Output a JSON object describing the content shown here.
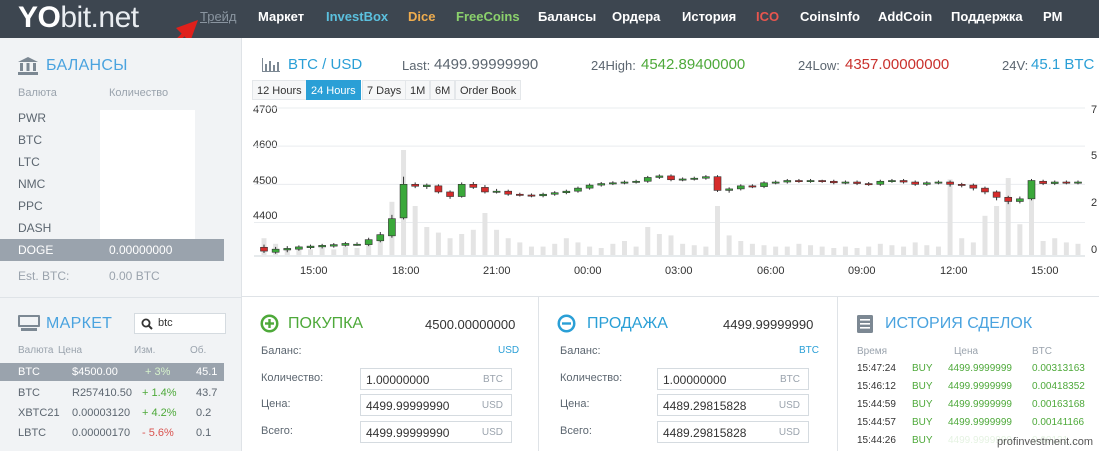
{
  "logo": {
    "yo": "YO",
    "rest": "bit.net"
  },
  "nav": [
    {
      "label": "Трейд",
      "color": "#8a95a0"
    },
    {
      "label": "Маркет",
      "color": "#ffffff"
    },
    {
      "label": "InvestBox",
      "color": "#5bc0de"
    },
    {
      "label": "Dice",
      "color": "#f0ad4e"
    },
    {
      "label": "FreeCoins",
      "color": "#8bd16c"
    },
    {
      "label": "Балансы",
      "color": "#ffffff"
    },
    {
      "label": "Ордера",
      "color": "#ffffff"
    },
    {
      "label": "История",
      "color": "#ffffff"
    },
    {
      "label": "ICO",
      "color": "#e8554e"
    },
    {
      "label": "CoinsInfo",
      "color": "#ffffff"
    },
    {
      "label": "AddCoin",
      "color": "#ffffff"
    },
    {
      "label": "Поддержка",
      "color": "#ffffff"
    },
    {
      "label": "PM",
      "color": "#ffffff"
    }
  ],
  "balances": {
    "title": "БАЛАНСЫ",
    "col_currency": "Валюта",
    "col_amount": "Количество",
    "rows": [
      {
        "currency": "PWR",
        "amount": ""
      },
      {
        "currency": "BTC",
        "amount": ""
      },
      {
        "currency": "LTC",
        "amount": ""
      },
      {
        "currency": "NMC",
        "amount": ""
      },
      {
        "currency": "PPC",
        "amount": ""
      },
      {
        "currency": "DASH",
        "amount": ""
      },
      {
        "currency": "DOGE",
        "amount": "0.00000000"
      }
    ],
    "est_label": "Est. BTC:",
    "est_value": "0.00 BTC"
  },
  "market": {
    "title": "МАРКЕТ",
    "search_value": "btc",
    "cols": [
      "Валюта",
      "Цена",
      "Изм.",
      "Об."
    ],
    "rows": [
      {
        "cur": "BTC",
        "price": "$4500.00",
        "change": "+ 3%",
        "vol": "45.1",
        "dir": "up"
      },
      {
        "cur": "BTC",
        "price": "R257410.50",
        "change": "+ 1.4%",
        "vol": "43.7",
        "dir": "up"
      },
      {
        "cur": "XBTC21",
        "price": "0.00003120",
        "change": "+ 4.2%",
        "vol": "0.2",
        "dir": "up"
      },
      {
        "cur": "LBTC",
        "price": "0.00000170",
        "change": "- 5.6%",
        "vol": "0.1",
        "dir": "down"
      }
    ]
  },
  "ticker": {
    "pair": "BTC / USD",
    "last_label": "Last:",
    "last": "4499.99999990",
    "high_label": "24High:",
    "high": "4542.89400000",
    "low_label": "24Low:",
    "low": "4357.00000000",
    "vol_label": "24V:",
    "vol": "45.1 BTC"
  },
  "timeframes": [
    "12 Hours",
    "24 Hours",
    "7 Days",
    "1M",
    "6M",
    "Order Book"
  ],
  "active_timeframe": "24 Hours",
  "chart_data": {
    "type": "candlestick",
    "x_ticks": [
      "15:00",
      "18:00",
      "21:00",
      "00:00",
      "03:00",
      "06:00",
      "09:00",
      "12:00",
      "15:00"
    ],
    "y_ticks": [
      4700,
      4600,
      4500,
      4400
    ],
    "ylim": [
      4320,
      4700
    ],
    "volume_axis_ticks": [
      "7",
      "5",
      "2",
      "0"
    ],
    "grid": true,
    "candles": [
      [
        4335,
        4325,
        4342,
        4320
      ],
      [
        4322,
        4330,
        4336,
        4318
      ],
      [
        4328,
        4332,
        4338,
        4322
      ],
      [
        4330,
        4336,
        4340,
        4326
      ],
      [
        4334,
        4338,
        4342,
        4330
      ],
      [
        4336,
        4340,
        4344,
        4332
      ],
      [
        4338,
        4342,
        4346,
        4334
      ],
      [
        4340,
        4345,
        4349,
        4337
      ],
      [
        4342,
        4343,
        4348,
        4339
      ],
      [
        4342,
        4355,
        4360,
        4338
      ],
      [
        4352,
        4368,
        4375,
        4348
      ],
      [
        4365,
        4410,
        4420,
        4360
      ],
      [
        4412,
        4500,
        4520,
        4408
      ],
      [
        4500,
        4495,
        4505,
        4490
      ],
      [
        4494,
        4498,
        4502,
        4488
      ],
      [
        4496,
        4480,
        4500,
        4476
      ],
      [
        4480,
        4468,
        4484,
        4462
      ],
      [
        4468,
        4500,
        4505,
        4465
      ],
      [
        4500,
        4492,
        4506,
        4488
      ],
      [
        4492,
        4480,
        4498,
        4476
      ],
      [
        4482,
        4482,
        4488,
        4476
      ],
      [
        4482,
        4474,
        4486,
        4470
      ],
      [
        4474,
        4472,
        4478,
        4468
      ],
      [
        4472,
        4470,
        4476,
        4466
      ],
      [
        4470,
        4474,
        4478,
        4466
      ],
      [
        4474,
        4478,
        4482,
        4470
      ],
      [
        4478,
        4482,
        4486,
        4474
      ],
      [
        4482,
        4490,
        4494,
        4478
      ],
      [
        4490,
        4498,
        4502,
        4486
      ],
      [
        4498,
        4502,
        4506,
        4494
      ],
      [
        4502,
        4504,
        4508,
        4498
      ],
      [
        4504,
        4506,
        4510,
        4500
      ],
      [
        4506,
        4508,
        4512,
        4502
      ],
      [
        4508,
        4518,
        4522,
        4504
      ],
      [
        4518,
        4522,
        4526,
        4514
      ],
      [
        4522,
        4512,
        4526,
        4508
      ],
      [
        4512,
        4514,
        4518,
        4508
      ],
      [
        4514,
        4516,
        4520,
        4510
      ],
      [
        4516,
        4520,
        4524,
        4512
      ],
      [
        4520,
        4484,
        4524,
        4480
      ],
      [
        4484,
        4488,
        4492,
        4478
      ],
      [
        4488,
        4496,
        4500,
        4484
      ],
      [
        4496,
        4494,
        4500,
        4490
      ],
      [
        4494,
        4504,
        4508,
        4490
      ],
      [
        4504,
        4506,
        4510,
        4500
      ],
      [
        4506,
        4510,
        4514,
        4502
      ],
      [
        4510,
        4508,
        4514,
        4504
      ],
      [
        4508,
        4510,
        4514,
        4504
      ],
      [
        4510,
        4508,
        4512,
        4504
      ],
      [
        4508,
        4504,
        4512,
        4500
      ],
      [
        4504,
        4506,
        4510,
        4500
      ],
      [
        4506,
        4502,
        4510,
        4498
      ],
      [
        4502,
        4500,
        4506,
        4496
      ],
      [
        4500,
        4508,
        4512,
        4496
      ],
      [
        4508,
        4510,
        4514,
        4504
      ],
      [
        4510,
        4506,
        4514,
        4502
      ],
      [
        4506,
        4500,
        4510,
        4496
      ],
      [
        4500,
        4504,
        4508,
        4496
      ],
      [
        4504,
        4506,
        4510,
        4500
      ],
      [
        4506,
        4500,
        4510,
        4494
      ],
      [
        4500,
        4498,
        4504,
        4492
      ],
      [
        4498,
        4490,
        4502,
        4484
      ],
      [
        4490,
        4480,
        4494,
        4474
      ],
      [
        4480,
        4466,
        4484,
        4458
      ],
      [
        4466,
        4455,
        4470,
        4448
      ],
      [
        4455,
        4462,
        4468,
        4450
      ],
      [
        4462,
        4510,
        4514,
        4458
      ],
      [
        4508,
        4502,
        4512,
        4498
      ],
      [
        4502,
        4506,
        4510,
        4498
      ],
      [
        4506,
        4504,
        4510,
        4500
      ],
      [
        4504,
        4506,
        4510,
        4500
      ]
    ],
    "volumes": [
      1.2,
      0.8,
      0.5,
      0.6,
      0.4,
      0.5,
      0.4,
      0.6,
      0.5,
      0.9,
      1.5,
      3.8,
      7.5,
      3.5,
      2.0,
      1.6,
      1.2,
      1.5,
      1.8,
      3.0,
      1.8,
      1.2,
      0.9,
      0.6,
      0.6,
      0.8,
      1.2,
      0.9,
      0.6,
      0.5,
      0.8,
      1.0,
      0.6,
      2.0,
      1.5,
      1.4,
      0.8,
      0.7,
      0.6,
      3.5,
      1.4,
      1.0,
      0.8,
      0.7,
      0.6,
      0.6,
      0.8,
      0.7,
      0.6,
      0.5,
      0.6,
      0.5,
      0.6,
      0.8,
      0.7,
      0.6,
      0.9,
      0.7,
      0.6,
      5.4,
      1.2,
      0.9,
      2.8,
      3.5,
      5.5,
      2.2,
      4.6,
      1.0,
      1.2,
      0.9,
      0.8
    ]
  },
  "buy": {
    "title": "ПОКУПКА",
    "price": "4500.00000000",
    "balance_label": "Баланс:",
    "balance_cur": "USD",
    "qty_label": "Количество:",
    "qty": "1.00000000",
    "qty_cur": "BTC",
    "price_label": "Цена:",
    "price_val": "4499.99999990",
    "price_cur": "USD",
    "total_label": "Всего:",
    "total": "4499.99999990",
    "total_cur": "USD"
  },
  "sell": {
    "title": "ПРОДАЖА",
    "price": "4499.99999990",
    "balance_label": "Баланс:",
    "balance_cur": "BTC",
    "qty_label": "Количество:",
    "qty": "1.00000000",
    "qty_cur": "BTC",
    "price_label": "Цена:",
    "price_val": "4489.29815828",
    "price_cur": "USD",
    "total_label": "Всего:",
    "total": "4489.29815828",
    "total_cur": "USD"
  },
  "history": {
    "title": "ИСТОРИЯ СДЕЛОК",
    "cols": [
      "Время",
      "Цена",
      "BTC"
    ],
    "rows": [
      {
        "time": "15:47:24",
        "type": "BUY",
        "price": "4499.9999999",
        "btc": "0.00313163"
      },
      {
        "time": "15:46:12",
        "type": "BUY",
        "price": "4499.9999999",
        "btc": "0.00418352"
      },
      {
        "time": "15:44:59",
        "type": "BUY",
        "price": "4499.9999999",
        "btc": "0.00163168"
      },
      {
        "time": "15:44:57",
        "type": "BUY",
        "price": "4499.9999999",
        "btc": "0.00141166"
      },
      {
        "time": "15:44:26",
        "type": "BUY",
        "price": "4499.9999999",
        "btc": "0.00131..."
      }
    ]
  },
  "watermark": "profinvestment.com",
  "colors": {
    "accent": "#2a9fd6",
    "up": "#4ea93a",
    "down": "#d9534f",
    "candle_up": "#3aa83a",
    "candle_down": "#d62b2b"
  }
}
